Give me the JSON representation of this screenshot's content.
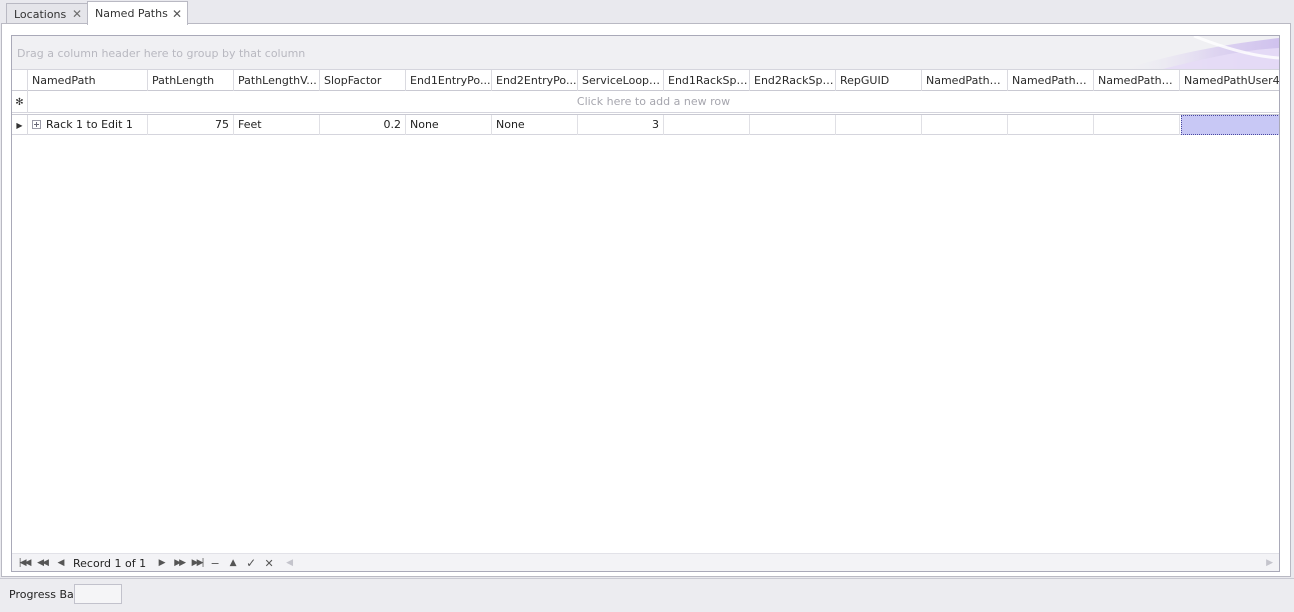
{
  "tabs": [
    {
      "label": "Locations",
      "active": false
    },
    {
      "label": "Named Paths",
      "active": true
    }
  ],
  "grid": {
    "group_hint": "Drag a column header here to group by that column",
    "new_row_hint": "Click here to add a new row",
    "columns": [
      "NamedPath",
      "PathLength",
      "PathLengthV...",
      "SlopFactor",
      "End1EntryPo...",
      "End2EntryPo...",
      "ServiceLoopL...",
      "End1RackSpa...",
      "End2RackSpa...",
      "RepGUID",
      "NamedPathU...",
      "NamedPathU...",
      "NamedPathU...",
      "NamedPathUser4"
    ],
    "rows": [
      {
        "NamedPath": "Rack 1 to Edit 1",
        "PathLength": "75",
        "PathLengthV": "Feet",
        "SlopFactor": "0.2",
        "End1EntryPo": "None",
        "End2EntryPo": "None",
        "ServiceLoopL": "3",
        "End1RackSpa": "",
        "End2RackSpa": "",
        "RepGUID": "",
        "NamedPathU1": "",
        "NamedPathU2": "",
        "NamedPathU3": "",
        "NamedPathUser4": ""
      }
    ]
  },
  "navigator": {
    "record_text": "Record 1 of 1"
  },
  "statusbar": {
    "label": "Progress Bar"
  },
  "colors": {
    "selection": "#c8c8f5",
    "header_border": "#c9c9d2",
    "background": "#e9e9ee"
  }
}
